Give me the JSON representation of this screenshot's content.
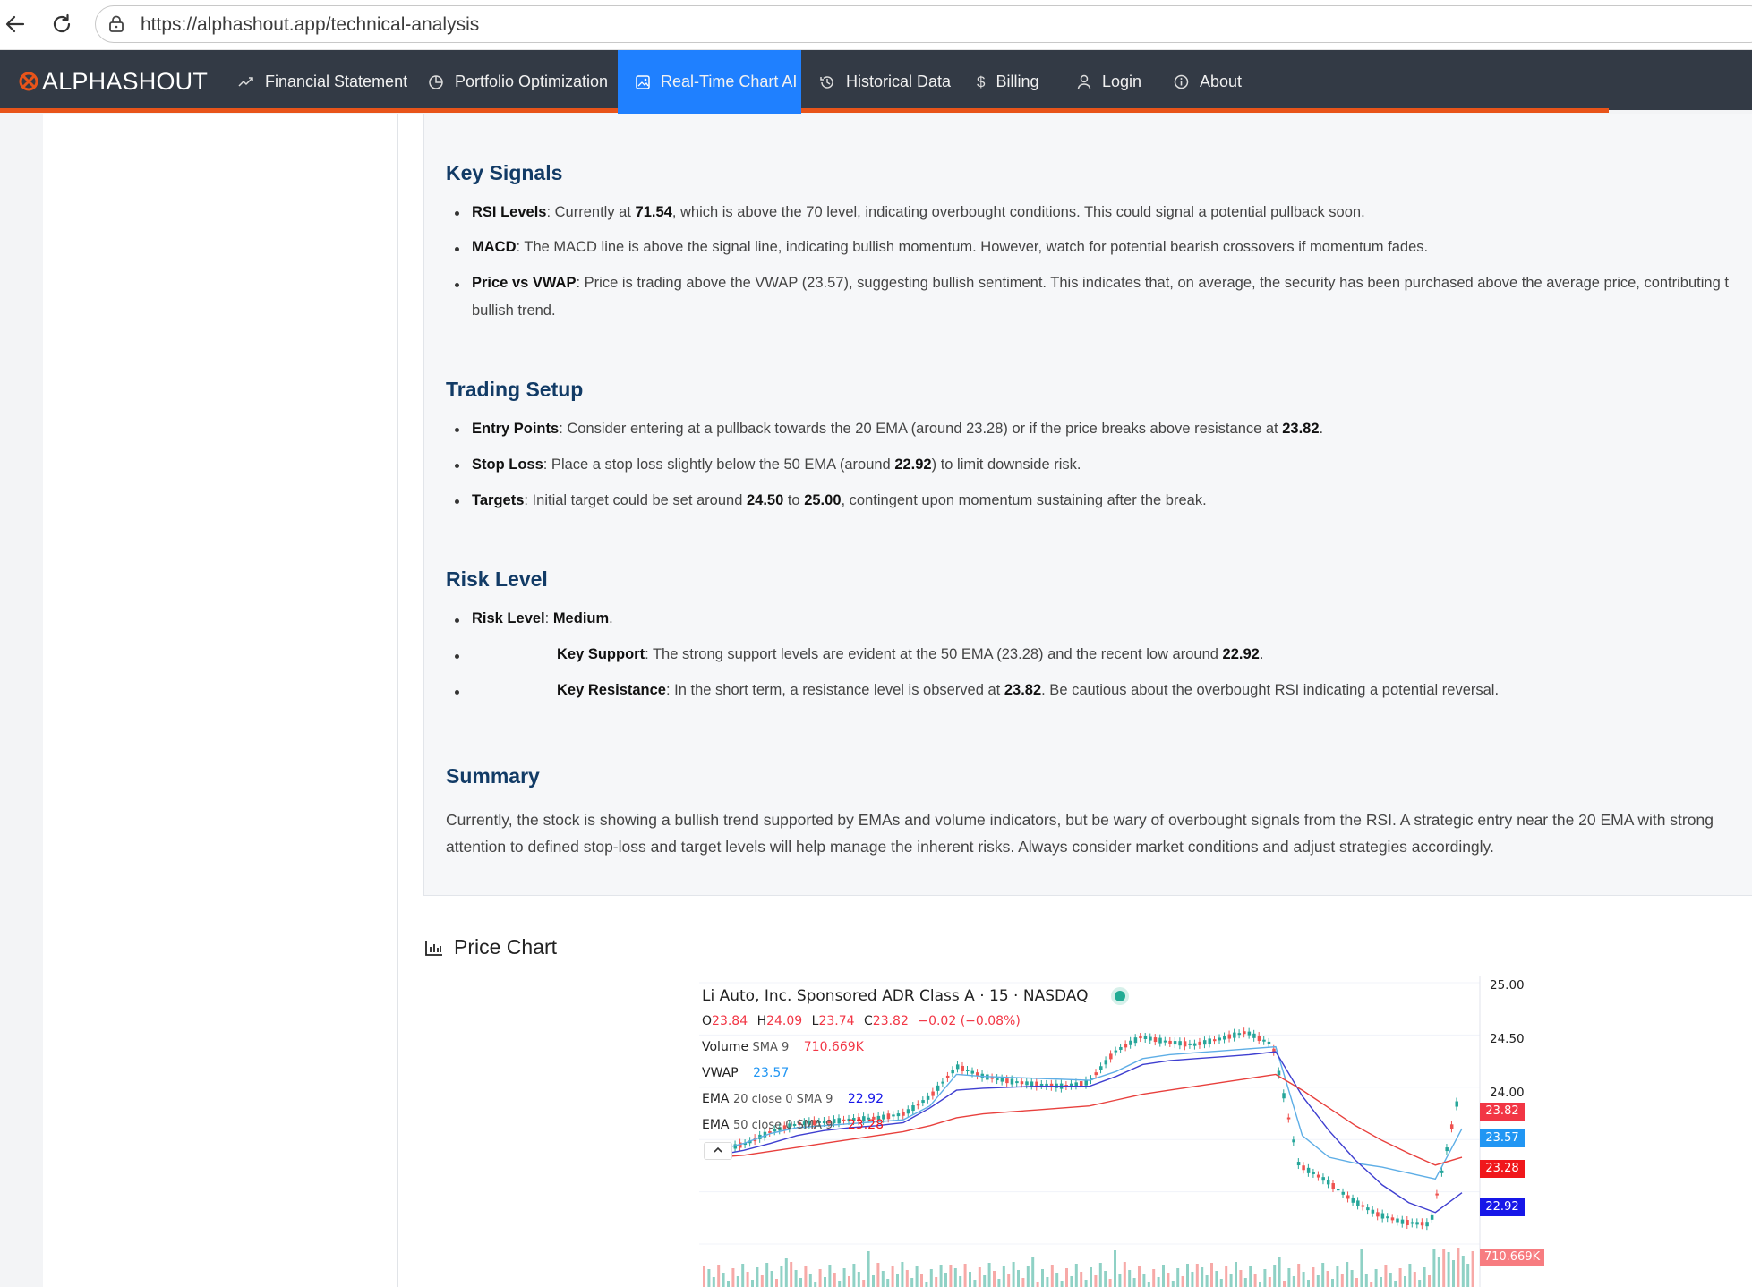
{
  "browser": {
    "url": "https://alphashout.app/technical-analysis"
  },
  "brand": {
    "name": "ALPHASHOUT"
  },
  "nav": {
    "items": [
      {
        "label": "Financial Statement",
        "icon": "trending-up-icon"
      },
      {
        "label": "Portfolio Optimization",
        "icon": "pie-chart-icon"
      },
      {
        "label": "Real-Time Chart AI",
        "icon": "image-icon",
        "active": true
      },
      {
        "label": "Historical Data",
        "icon": "history-icon"
      },
      {
        "label": "Billing",
        "icon": "dollar-icon"
      },
      {
        "label": "Login",
        "icon": "user-icon"
      },
      {
        "label": "About",
        "icon": "info-icon"
      }
    ]
  },
  "colors": {
    "nav_bg": "#333a45",
    "accent": "#e8541a",
    "active_tab": "#1f80ff",
    "heading": "#123b66",
    "up": "#26a69a",
    "down": "#ef5350"
  },
  "analysis": {
    "key_signals": {
      "title": "Key Signals",
      "rsi": {
        "label": "RSI Levels",
        "pre": ": Currently at ",
        "value": "71.54",
        "post": ", which is above the 70 level, indicating overbought conditions. This could signal a potential pullback soon."
      },
      "macd": {
        "label": "MACD",
        "text": ": The MACD line is above the signal line, indicating bullish momentum. However, watch for potential bearish crossovers if momentum fades."
      },
      "vwap": {
        "label": "Price vs VWAP",
        "text": ": Price is trading above the VWAP (23.57), suggesting bullish sentiment. This indicates that, on average, the security has been purchased above the average price, contributing t",
        "text2": "bullish trend."
      }
    },
    "trading_setup": {
      "title": "Trading Setup",
      "entry": {
        "label": "Entry Points",
        "text": ": Consider entering at a pullback towards the 20 EMA (around 23.28) or if the price breaks above resistance at ",
        "value": "23.82",
        "post": "."
      },
      "stop": {
        "label": "Stop Loss",
        "pre": ": Place a stop loss slightly below the 50 EMA (around ",
        "value": "22.92",
        "post": ") to limit downside risk."
      },
      "targets": {
        "label": "Targets",
        "pre": ": Initial target could be set around ",
        "v1": "24.50",
        "mid": " to ",
        "v2": "25.00",
        "post": ", contingent upon momentum sustaining after the break."
      }
    },
    "risk": {
      "title": "Risk Level",
      "level": {
        "label": "Risk Level",
        "sep": ": ",
        "value": "Medium",
        "post": "."
      },
      "support": {
        "label": "Key Support",
        "pre": ": The strong support levels are evident at the 50 EMA (23.28) and the recent low around ",
        "value": "22.92",
        "post": "."
      },
      "resistance": {
        "label": "Key Resistance",
        "pre": ": In the short term, a resistance level is observed at ",
        "value": "23.82",
        "post": ". Be cautious about the overbought RSI indicating a potential reversal."
      }
    },
    "summary": {
      "title": "Summary",
      "line1": "Currently, the stock is showing a bullish trend supported by EMAs and volume indicators, but be wary of overbought signals from the RSI. A strategic entry near the 20 EMA with strong",
      "line2": "attention to defined stop-loss and target levels will help manage the inherent risks. Always consider market conditions and adjust strategies accordingly."
    }
  },
  "price_chart": {
    "heading": "Price Chart",
    "symbol_line": "Li Auto, Inc. Sponsored ADR Class A · 15 · NASDAQ",
    "ohlc": {
      "o_label": "O",
      "o": "23.84",
      "h_label": "H",
      "h": "24.09",
      "l_label": "L",
      "l": "23.74",
      "c_label": "C",
      "c": "23.82",
      "chg": "−0.02 (−0.08%)"
    },
    "volume": {
      "label": "Volume",
      "param": "SMA 9",
      "value": "710.669K"
    },
    "vwap": {
      "label": "VWAP",
      "value": "23.57"
    },
    "ema20": {
      "label": "EMA",
      "param": "20 close 0 SMA 9",
      "value": "22.92"
    },
    "ema50": {
      "label": "EMA",
      "param": "50 close 0 SMA 9",
      "value": "23.28"
    },
    "axis_ticks": [
      "25.00",
      "24.50",
      "24.00"
    ],
    "price_tags": [
      {
        "value": "23.82",
        "color": "#f23645"
      },
      {
        "value": "23.57",
        "color": "#2196f3"
      },
      {
        "value": "23.28",
        "color": "#f0171b"
      },
      {
        "value": "22.92",
        "color": "#1717e8"
      },
      {
        "value": "710.669K",
        "color": "#f77c80"
      }
    ]
  },
  "chart_data": {
    "type": "line",
    "title": "Li Auto, Inc. Sponsored ADR Class A · 15 · NASDAQ",
    "xlabel": "",
    "ylabel": "",
    "ylim": [
      22.4,
      25.05
    ],
    "series": [
      {
        "name": "",
        "values": [
          23.35,
          23.42,
          23.55,
          23.62,
          23.64,
          23.66,
          23.68,
          23.72,
          23.9,
          24.2,
          24.1,
          24.05,
          24.02,
          24.0,
          24.04,
          24.35,
          24.5,
          24.45,
          24.42,
          24.48,
          24.55,
          24.42,
          23.2,
          23.05,
          22.85,
          22.7,
          22.62,
          22.6,
          23.82
        ]
      },
      {
        "name": "VWAP",
        "values": [
          23.35,
          23.42,
          23.52,
          23.58,
          23.6,
          23.62,
          23.64,
          23.66,
          23.8,
          24.12,
          24.1,
          24.09,
          24.08,
          24.07,
          24.06,
          24.15,
          24.28,
          24.32,
          24.34,
          24.36,
          24.38,
          24.4,
          23.5,
          23.28,
          23.22,
          23.18,
          23.12,
          23.06,
          23.57
        ]
      },
      {
        "name": "EMA 20",
        "values": [
          23.3,
          23.35,
          23.42,
          23.5,
          23.55,
          23.58,
          23.6,
          23.63,
          23.78,
          23.96,
          23.98,
          23.99,
          24.0,
          24.0,
          24.0,
          24.1,
          24.22,
          24.26,
          24.28,
          24.3,
          24.32,
          24.35,
          23.9,
          23.55,
          23.25,
          23.0,
          22.82,
          22.72,
          22.92
        ]
      },
      {
        "name": "EMA 50",
        "values": [
          23.28,
          23.3,
          23.34,
          23.38,
          23.42,
          23.46,
          23.5,
          23.54,
          23.6,
          23.68,
          23.72,
          23.74,
          23.76,
          23.78,
          23.8,
          23.86,
          23.92,
          23.96,
          24.0,
          24.04,
          24.08,
          24.12,
          23.96,
          23.78,
          23.6,
          23.45,
          23.32,
          23.2,
          23.28
        ]
      }
    ]
  }
}
